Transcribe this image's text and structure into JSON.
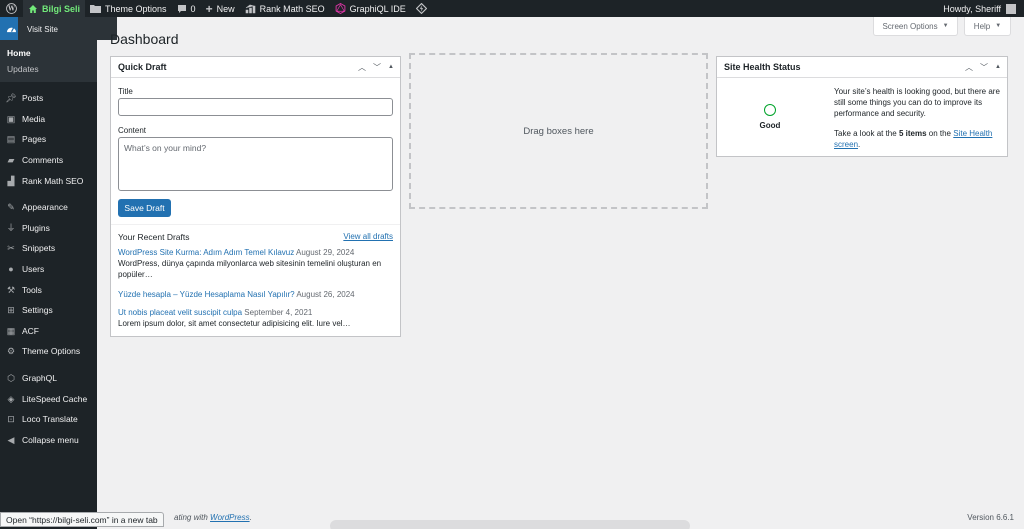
{
  "admin_bar": {
    "site_name": "Bilgi Seli",
    "theme_options": "Theme Options",
    "comments_count": "0",
    "new_label": "New",
    "rank_math": "Rank Math SEO",
    "graphiql": "GraphiQL IDE",
    "howdy": "Howdy, Sheriff"
  },
  "site_dropdown": {
    "visit_site": "Visit Site"
  },
  "sidebar": {
    "submenu": [
      {
        "label": "Home",
        "current": true
      },
      {
        "label": "Updates"
      }
    ],
    "items": [
      {
        "label": "Posts",
        "icon": "pin-icon"
      },
      {
        "label": "Media",
        "icon": "media-icon"
      },
      {
        "label": "Pages",
        "icon": "pages-icon"
      },
      {
        "label": "Comments",
        "icon": "comments-icon"
      },
      {
        "label": "Rank Math SEO",
        "icon": "rank-math-icon"
      },
      {
        "label": "Appearance",
        "icon": "brush-icon"
      },
      {
        "label": "Plugins",
        "icon": "plug-icon"
      },
      {
        "label": "Snippets",
        "icon": "snippets-icon"
      },
      {
        "label": "Users",
        "icon": "users-icon"
      },
      {
        "label": "Tools",
        "icon": "wrench-icon"
      },
      {
        "label": "Settings",
        "icon": "settings-icon"
      },
      {
        "label": "ACF",
        "icon": "acf-icon"
      },
      {
        "label": "Theme Options",
        "icon": "gear-icon"
      },
      {
        "label": "GraphQL",
        "icon": "graphql-icon"
      },
      {
        "label": "LiteSpeed Cache",
        "icon": "litespeed-icon"
      },
      {
        "label": "Loco Translate",
        "icon": "translate-icon"
      },
      {
        "label": "Collapse menu",
        "icon": "collapse-icon"
      }
    ]
  },
  "screen_options": "Screen Options",
  "help": "Help",
  "page_title": "Dashboard",
  "quick_draft": {
    "title": "Quick Draft",
    "title_label": "Title",
    "title_value": "",
    "content_label": "Content",
    "content_placeholder": "What’s on your mind?",
    "save_button": "Save Draft",
    "recent_title": "Your Recent Drafts",
    "view_all": "View all drafts",
    "drafts": [
      {
        "title": "WordPress Site Kurma: Adım Adım Temel Kılavuz",
        "date": "August 29, 2024",
        "excerpt": "WordPress, dünya çapında milyonlarca web sitesinin temelini oluşturan en popüler…"
      },
      {
        "title": "Yüzde hesapla – Yüzde Hesaplama Nasıl Yapılır?",
        "date": "August 26, 2024",
        "excerpt": ""
      },
      {
        "title": "Ut nobis placeat velit suscipit culpa",
        "date": "September 4, 2021",
        "excerpt": "Lorem ipsum dolor, sit amet consectetur adipisicing elit. Iure vel…"
      }
    ]
  },
  "drag_area": "Drag boxes here",
  "site_health": {
    "title": "Site Health Status",
    "status": "Good",
    "text1": "Your site’s health is looking good, but there are still some things you can do to improve its performance and security.",
    "text2_prefix": "Take a look at the",
    "text2_items": "5 items",
    "text2_mid": "on the",
    "text2_link": "Site Health screen",
    "text2_suffix": "."
  },
  "footer": {
    "left_prefix": "ating with",
    "left_link": "WordPress",
    "left_suffix": ".",
    "version": "Version 6.6.1"
  },
  "status_tip": "Open “https://bilgi-seli.com” in a new tab",
  "colors": {
    "admin_bar": "#1d2327",
    "accent": "#2271b1",
    "health_good": "#00a32a"
  }
}
